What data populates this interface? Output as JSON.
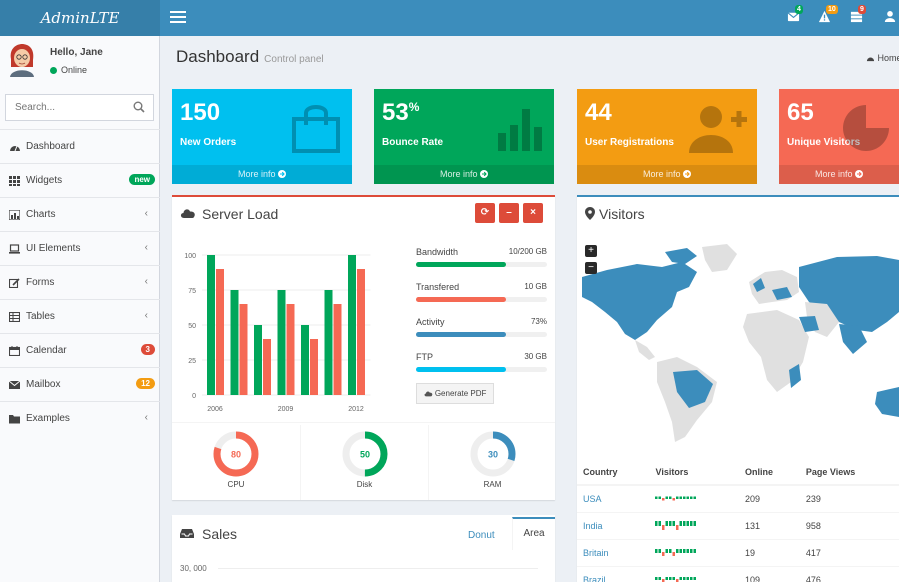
{
  "app": {
    "logo": "AdminLTE"
  },
  "navbar": {
    "badges": {
      "messages": "4",
      "notifications": "10",
      "tasks": "9"
    },
    "colors": {
      "messages": "#00a65a",
      "notifications": "#f39c12",
      "tasks": "#dd4b39"
    }
  },
  "user": {
    "name": "Hello, Jane",
    "status": "Online"
  },
  "search": {
    "placeholder": "Search..."
  },
  "sidebar": {
    "items": [
      {
        "label": "Dashboard",
        "icon": "dashboard-icon"
      },
      {
        "label": "Widgets",
        "icon": "widgets-icon",
        "badge": "new",
        "badge_color": "#00a65a"
      },
      {
        "label": "Charts",
        "icon": "charts-icon",
        "chevron": "‹"
      },
      {
        "label": "UI Elements",
        "icon": "laptop-icon",
        "chevron": "‹"
      },
      {
        "label": "Forms",
        "icon": "edit-icon",
        "chevron": "‹"
      },
      {
        "label": "Tables",
        "icon": "table-icon",
        "chevron": "‹"
      },
      {
        "label": "Calendar",
        "icon": "calendar-icon",
        "badge": "3",
        "badge_color": "#dd4b39"
      },
      {
        "label": "Mailbox",
        "icon": "envelope-icon",
        "badge": "12",
        "badge_color": "#f39c12"
      },
      {
        "label": "Examples",
        "icon": "folder-icon",
        "chevron": "‹"
      }
    ]
  },
  "header": {
    "title": "Dashboard",
    "subtitle": "Control panel",
    "breadcrumb": "Home"
  },
  "stats": [
    {
      "value": "150",
      "suffix": "",
      "label": "New Orders",
      "more": "More info",
      "color": "#00c0ef",
      "icon": "shopping-bag-icon"
    },
    {
      "value": "53",
      "suffix": "%",
      "label": "Bounce Rate",
      "more": "More info",
      "color": "#00a65a",
      "icon": "bar-chart-icon"
    },
    {
      "value": "44",
      "suffix": "",
      "label": "User Registrations",
      "more": "More info",
      "color": "#f39c12",
      "icon": "user-add-icon"
    },
    {
      "value": "65",
      "suffix": "",
      "label": "Unique Visitors",
      "more": "More info",
      "color": "#f56954",
      "icon": "pie-chart-icon"
    }
  ],
  "server_load": {
    "title": "Server Load",
    "progress": [
      {
        "label": "Bandwidth",
        "value_text": "10/200 GB",
        "fraction": 0.69,
        "color": "#00a65a"
      },
      {
        "label": "Transfered",
        "value_text": "10 GB",
        "fraction": 0.69,
        "color": "#f56954"
      },
      {
        "label": "Activity",
        "value_text": "73%",
        "fraction": 0.69,
        "color": "#3c8dbc"
      },
      {
        "label": "FTP",
        "value_text": "30 GB",
        "fraction": 0.69,
        "color": "#00c0ef"
      }
    ],
    "button": "Generate PDF",
    "knobs": [
      {
        "label": "CPU",
        "value": 80,
        "color": "#f56954"
      },
      {
        "label": "Disk",
        "value": 50,
        "color": "#00a65a"
      },
      {
        "label": "RAM",
        "value": 30,
        "color": "#3c8dbc"
      }
    ]
  },
  "chart_data": {
    "type": "bar",
    "x": [
      2006,
      2007,
      2008,
      2009,
      2010,
      2011,
      2012
    ],
    "x_tick_labels": [
      "2006",
      "2009",
      "2012"
    ],
    "y_ticks": [
      "0",
      "25",
      "50",
      "75",
      "100"
    ],
    "ylim": [
      0,
      100
    ],
    "series": [
      {
        "values": [
          100,
          75,
          50,
          75,
          50,
          75,
          100
        ],
        "color": "#00a65a"
      },
      {
        "values": [
          90,
          65,
          40,
          65,
          40,
          65,
          90
        ],
        "color": "#f56954"
      }
    ],
    "title": "",
    "xlabel": "",
    "ylabel": ""
  },
  "visitors": {
    "title": "Visitors",
    "zoom_in": "+",
    "zoom_out": "−",
    "columns": [
      "Country",
      "Visitors",
      "Online",
      "Page Views"
    ],
    "rows": [
      {
        "country": "USA",
        "online": "209",
        "views": "239"
      },
      {
        "country": "India",
        "online": "131",
        "views": "958"
      },
      {
        "country": "Britain",
        "online": "19",
        "views": "417"
      },
      {
        "country": "Brazil",
        "online": "109",
        "views": "476"
      }
    ]
  },
  "sales": {
    "title": "Sales",
    "tabs": [
      "Donut",
      "Area"
    ],
    "axis_label": "30, 000"
  }
}
